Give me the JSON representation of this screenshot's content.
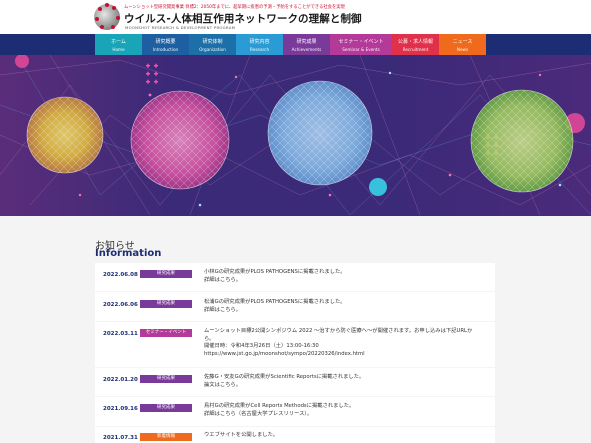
{
  "header": {
    "tagline": "ムーンショット型研究開発事業 目標2：2050年までに、超早期に疾患の予測・予防をすることができる社会を実現",
    "title": "ウイルス-人体相互作用ネットワークの理解と制御",
    "subtitle": "MOONSHOT RESEARCH & DEVELOPMENT PROGRAM"
  },
  "nav": {
    "items": [
      {
        "ja": "ホーム",
        "en": "Home"
      },
      {
        "ja": "研究概要",
        "en": "Introduction"
      },
      {
        "ja": "研究体制",
        "en": "Organization"
      },
      {
        "ja": "研究内容",
        "en": "Research"
      },
      {
        "ja": "研究成果",
        "en": "Achievements"
      },
      {
        "ja": "セミナー・イベント",
        "en": "Seminar & Events"
      },
      {
        "ja": "公募・求人情報",
        "en": "Recruitment"
      },
      {
        "ja": "ニュース",
        "en": "News"
      }
    ]
  },
  "section": {
    "title_ja": "お知らせ",
    "title_en": "Information"
  },
  "news": [
    {
      "date": "2022.06.08",
      "category": "研究成果",
      "lines": [
        "小林Gの研究成果がPLOS PATHOGENSに掲載されました。",
        "詳細はこちら。"
      ]
    },
    {
      "date": "2022.06.06",
      "category": "研究成果",
      "lines": [
        "松浦Gの研究成果がPLOS PATHOGENSに掲載されました。",
        "詳細はこちら。"
      ]
    },
    {
      "date": "2022.03.11",
      "category": "セミナー・イベント",
      "lines": [
        "ムーンショット目標2公開シンポジウム 2022 ～治すから防ぐ医療へ～が開催されます。お申し込みは下記URLか",
        "ら。",
        "開催日時：令和4年3月26日（土）13:00-16:30",
        "https://www.jst.go.jp/moonshot/sympo/20220326/index.html"
      ]
    },
    {
      "date": "2022.01.20",
      "category": "研究成果",
      "lines": [
        "佐藤G・安友Gの研究成果がScientific Reportsに掲載されました。",
        "論文はこちら。"
      ]
    },
    {
      "date": "2021.09.16",
      "category": "研究成果",
      "lines": [
        "鳥村Gの研究成果がCell Reports Methodsに掲載されました。",
        "詳細はこちら（名古屋大学プレスリリース）。"
      ]
    },
    {
      "date": "2021.07.31",
      "category": "新着情報",
      "lines": [
        "ウエブサイトを公開しました。"
      ]
    }
  ],
  "colors": {
    "nav_bg": "#1c2d74",
    "accent_results": "#7a3a9a",
    "accent_seminar": "#b43a9a",
    "accent_new": "#ef6a1c"
  }
}
